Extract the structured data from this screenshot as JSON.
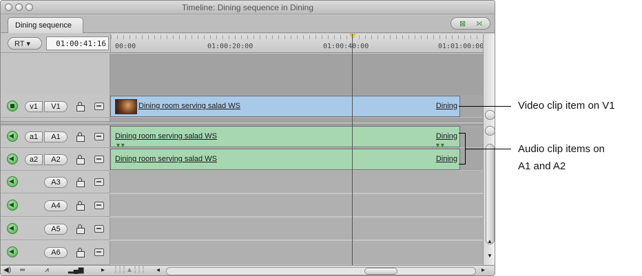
{
  "window": {
    "title": "Timeline: Dining sequence in Dining",
    "tab_label": "Dining sequence"
  },
  "controls": {
    "rt_label": "RT ▾",
    "timecode": "01:00:41:16"
  },
  "ruler": {
    "labels": [
      "00:00",
      "01:00:20:00",
      "01:00:40:00",
      "01:01:00:00"
    ]
  },
  "tracks": {
    "v1": {
      "source": "v1",
      "dest": "V1"
    },
    "a1": {
      "source": "a1",
      "dest": "A1"
    },
    "a2": {
      "source": "a2",
      "dest": "A2"
    },
    "a3": {
      "dest": "A3"
    },
    "a4": {
      "dest": "A4"
    },
    "a5": {
      "dest": "A5"
    },
    "a6": {
      "dest": "A6"
    }
  },
  "clips": {
    "v1": {
      "name": "Dining room serving salad WS",
      "end_name": "Dining"
    },
    "a1": {
      "name": "Dining room serving salad WS",
      "end_name": "Dining"
    },
    "a2": {
      "name": "Dining room serving salad WS",
      "end_name": "Dining"
    }
  },
  "callouts": {
    "video": "Video clip item on V1",
    "audio_line1": "Audio clip items on",
    "audio_line2": "A1 and A2"
  },
  "icons": [
    "close-icon",
    "minimize-icon",
    "zoom-icon",
    "speaker-icon",
    "lock-icon",
    "link-icon",
    "film-thumbnail-icon",
    "waveform-icon",
    "scroll-arrow-icon"
  ]
}
